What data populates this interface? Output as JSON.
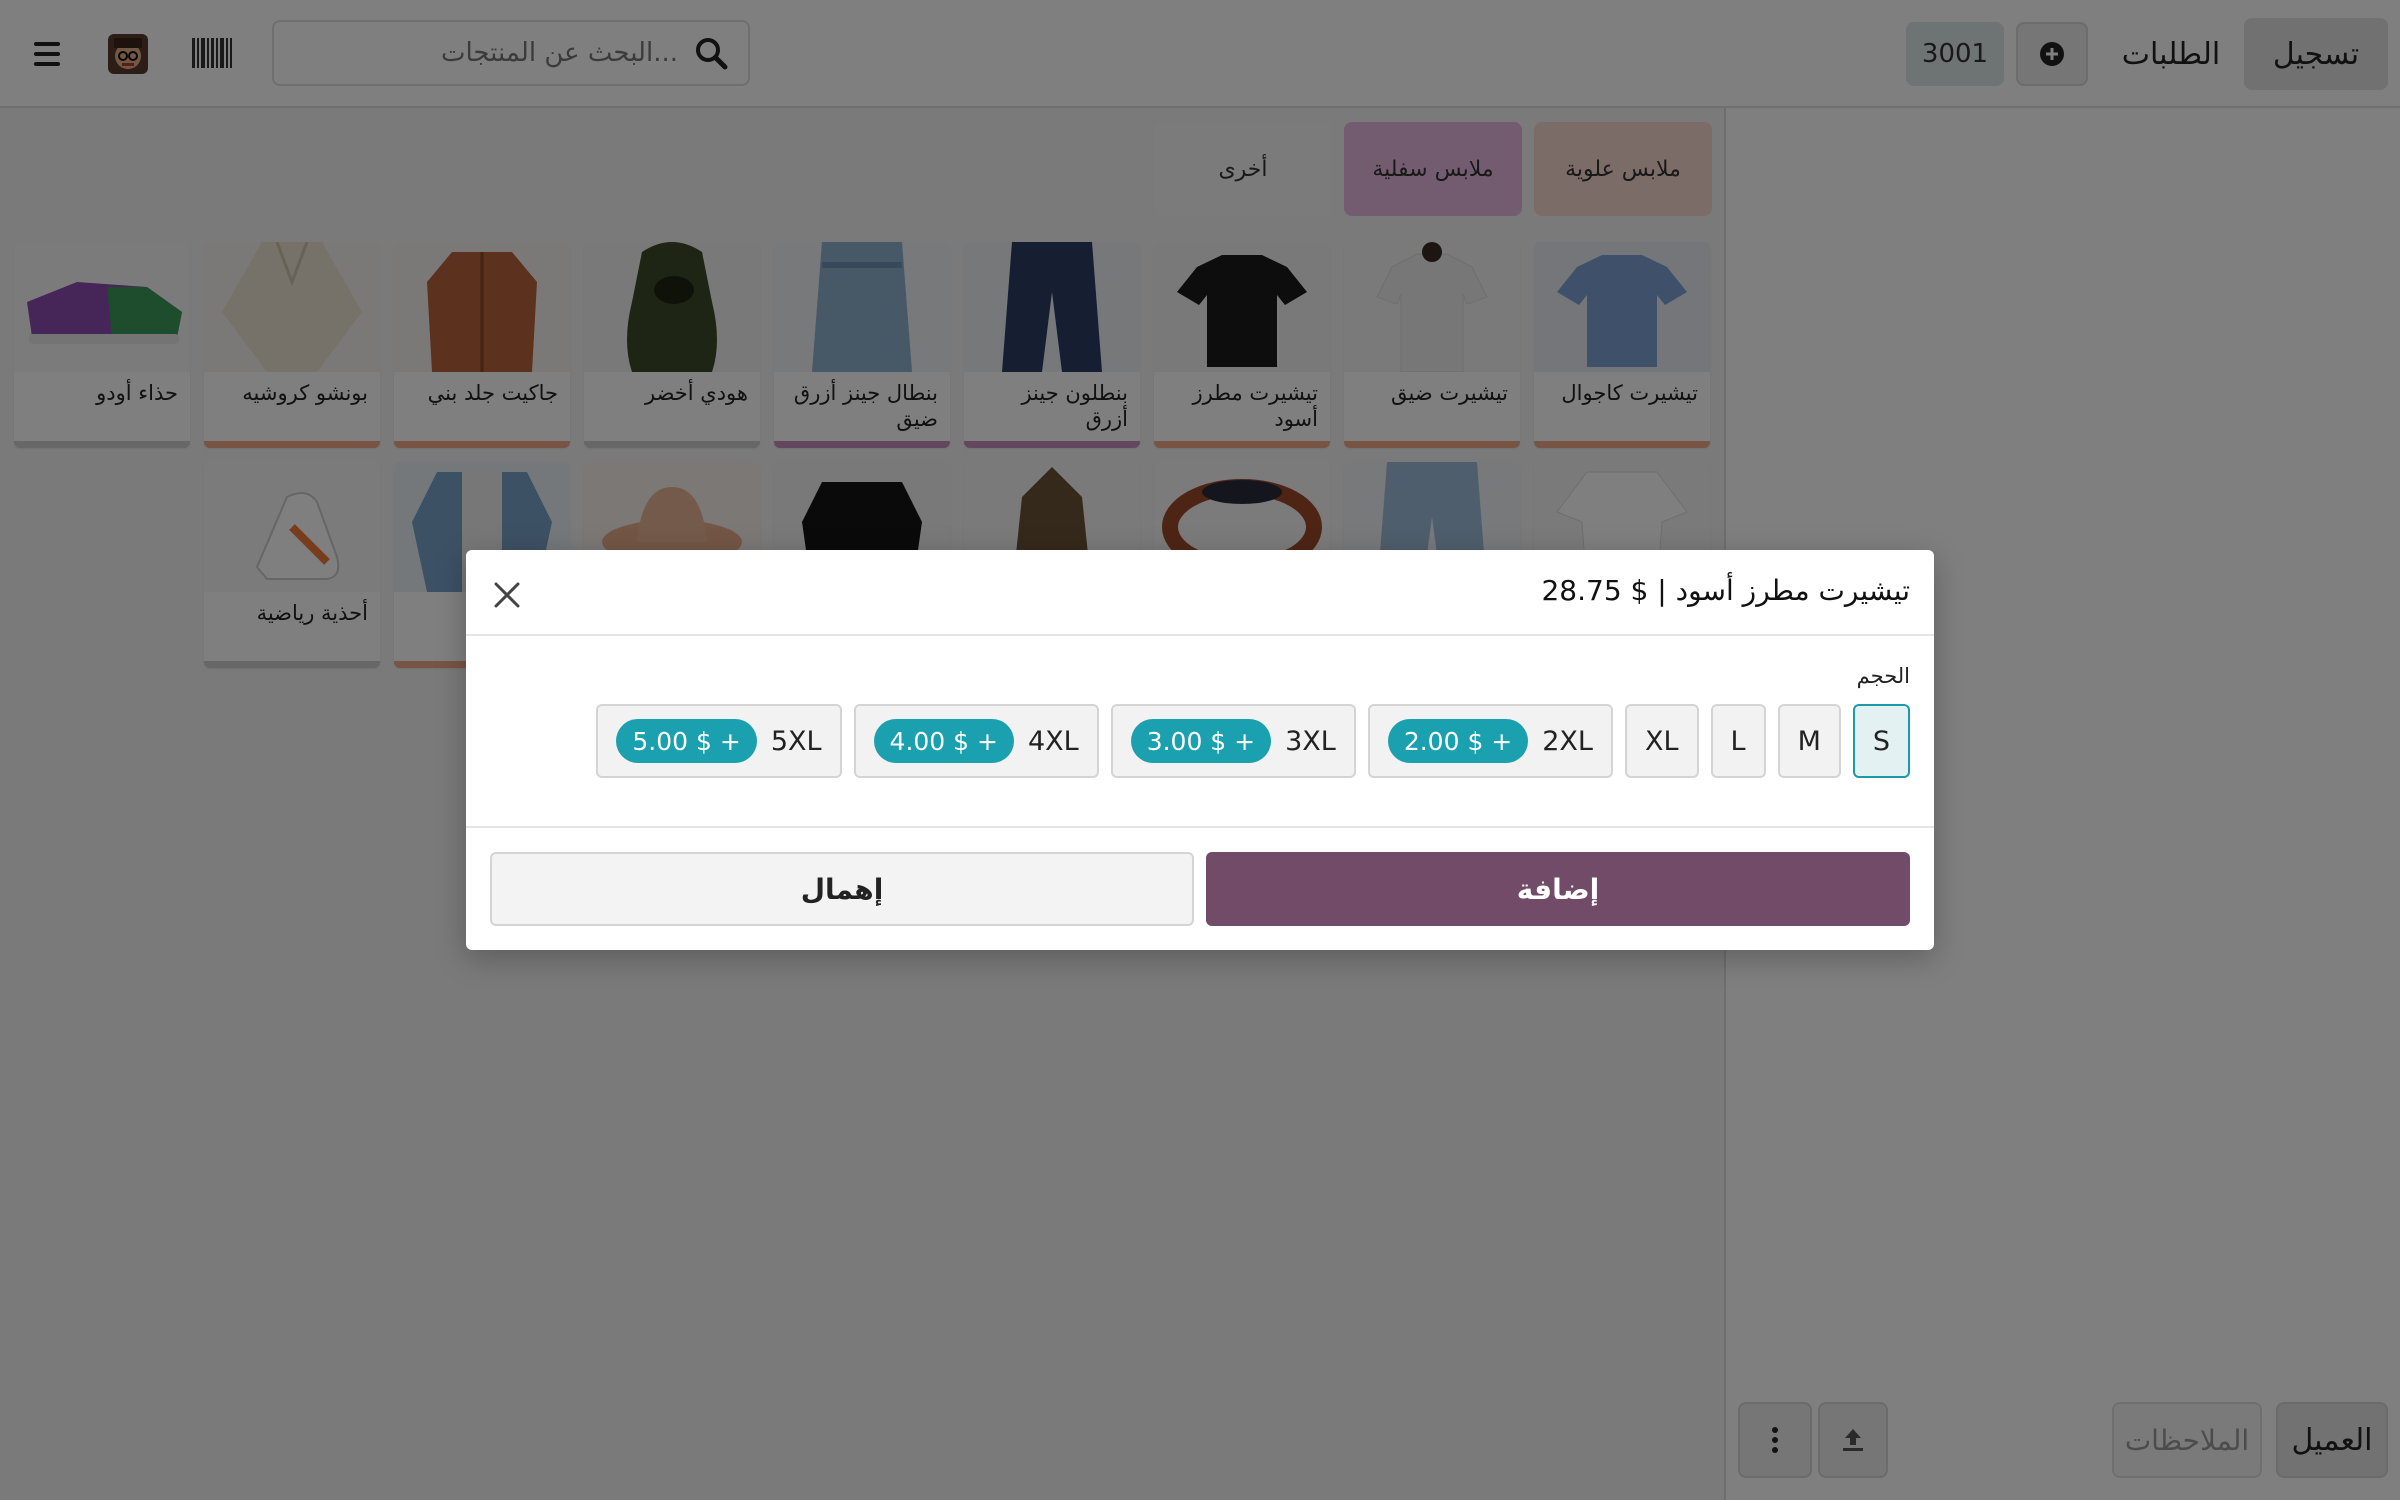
{
  "header": {
    "register_label": "تسجيل",
    "orders_label": "الطلبات",
    "order_number": "3001",
    "search_placeholder": "البحث عن المنتجات..."
  },
  "categories": [
    {
      "label": "ملابس علوية",
      "color": "#f7d9cf"
    },
    {
      "label": "ملابس سفلية",
      "color": "#e8b8e0"
    },
    {
      "label": "أخرى",
      "color": "#f6f6f6"
    }
  ],
  "products": [
    {
      "name": "تيشيرت كاجوال",
      "bar": "#f0a988"
    },
    {
      "name": "تيشيرت ضيق",
      "bar": "#f0a988"
    },
    {
      "name": "تيشيرت مطرز أسود",
      "bar": "#f0a988"
    },
    {
      "name": "بنطلون جينز أزرق",
      "bar": "#c48ebd"
    },
    {
      "name": "بنطال جينز أزرق ضيق",
      "bar": "#c48ebd"
    },
    {
      "name": "هودي أخضر",
      "bar": "#cfcfcf"
    },
    {
      "name": "جاكيت جلد بني",
      "bar": "#f0a988"
    },
    {
      "name": "بونشو كروشيه",
      "bar": "#f0a988"
    },
    {
      "name": "حذاء أودو",
      "bar": "#cfcfcf"
    }
  ],
  "products_row2": [
    {
      "name": "أحذية رياضية",
      "bar": "#cfcfcf"
    }
  ],
  "footer": {
    "customer_label": "العميل",
    "notes_label": "الملاحظات"
  },
  "modal": {
    "title": "تيشيرت مطرز أسود | $ 28.75",
    "attribute_label": "الحجم",
    "sizes": [
      {
        "label": "S",
        "extra": ""
      },
      {
        "label": "M",
        "extra": ""
      },
      {
        "label": "L",
        "extra": ""
      },
      {
        "label": "XL",
        "extra": ""
      },
      {
        "label": "2XL",
        "extra": "+ $ 2.00"
      },
      {
        "label": "3XL",
        "extra": "+ $ 3.00"
      },
      {
        "label": "4XL",
        "extra": "+ $ 4.00"
      },
      {
        "label": "5XL",
        "extra": "+ $ 5.00"
      }
    ],
    "selected_size": "S",
    "add_label": "إضافة",
    "discard_label": "إهمال"
  },
  "colors": {
    "primary": "#714b67",
    "accent": "#1ba0b0"
  }
}
